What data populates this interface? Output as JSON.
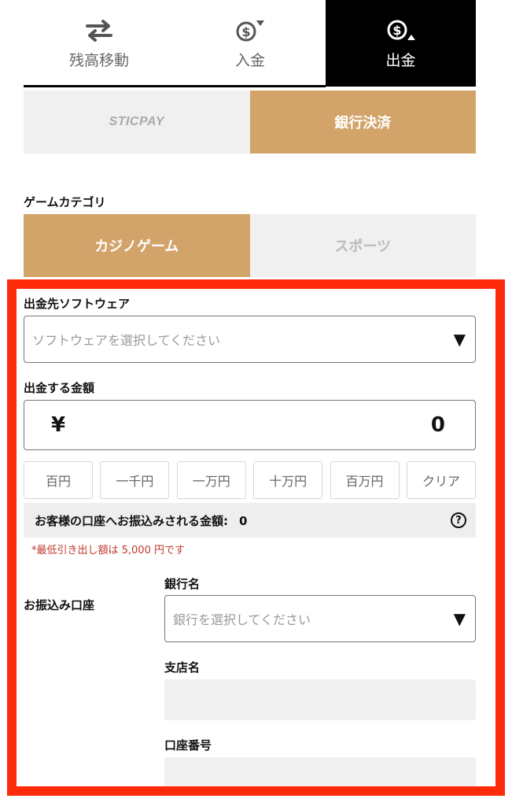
{
  "top_tabs": [
    {
      "label": "残高移動",
      "icon": "transfer-arrows-icon",
      "active": false
    },
    {
      "label": "入金",
      "icon": "dollar-coin-down-icon",
      "active": false
    },
    {
      "label": "出金",
      "icon": "dollar-coin-up-icon",
      "active": true
    }
  ],
  "method_tabs": [
    {
      "label": "STICPAY",
      "active": false
    },
    {
      "label": "銀行決済",
      "active": true
    }
  ],
  "category": {
    "label": "ゲームカテゴリ",
    "tabs": [
      {
        "label": "カジノゲーム",
        "active": true
      },
      {
        "label": "スポーツ",
        "active": false
      }
    ]
  },
  "form": {
    "software_label": "出金先ソフトウェア",
    "software_placeholder": "ソフトウェアを選択してください",
    "amount_label": "出金する金額",
    "currency_symbol": "¥",
    "amount_value": "0",
    "quick_buttons": [
      "百円",
      "一千円",
      "一万円",
      "十万円",
      "百万円",
      "クリア"
    ],
    "transfer_label": "お客様の口座へお振込みされる金額:",
    "transfer_value": "0",
    "min_note": "*最低引き出し額は 5,000 円です",
    "account_label": "お振込み口座",
    "bank_label": "銀行名",
    "bank_placeholder": "銀行を選択してください",
    "branch_label": "支店名",
    "account_number_label": "口座番号"
  },
  "colors": {
    "accent": "#d2a46a",
    "highlight": "#ff2a0a",
    "active_tab": "#000000"
  }
}
